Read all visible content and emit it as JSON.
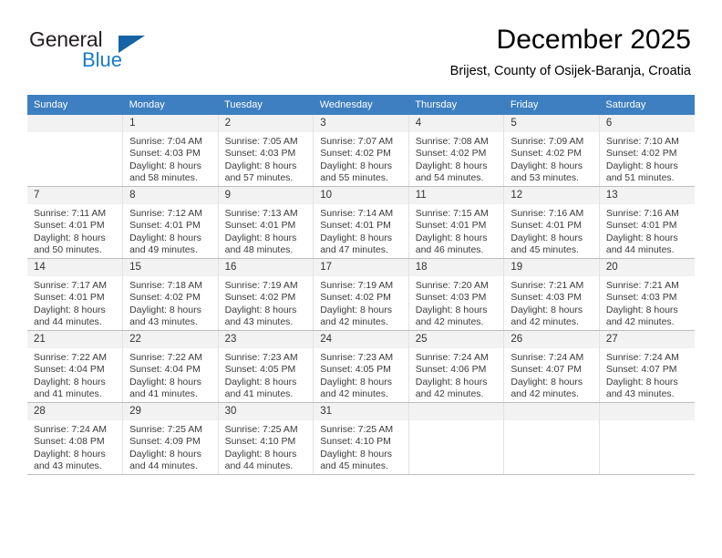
{
  "brand": {
    "name_top": "General",
    "name_bottom": "Blue",
    "triangle_color": "#1464a5",
    "blue_color": "#1a7bc6"
  },
  "header": {
    "title": "December 2025",
    "subtitle": "Brijest, County of Osijek-Baranja, Croatia",
    "header_bg": "#3d7fc1"
  },
  "weekdays": [
    "Sunday",
    "Monday",
    "Tuesday",
    "Wednesday",
    "Thursday",
    "Friday",
    "Saturday"
  ],
  "weeks": [
    [
      {
        "day": "",
        "sunrise": "",
        "sunset": "",
        "daylight1": "",
        "daylight2": ""
      },
      {
        "day": "1",
        "sunrise": "Sunrise: 7:04 AM",
        "sunset": "Sunset: 4:03 PM",
        "daylight1": "Daylight: 8 hours",
        "daylight2": "and 58 minutes."
      },
      {
        "day": "2",
        "sunrise": "Sunrise: 7:05 AM",
        "sunset": "Sunset: 4:03 PM",
        "daylight1": "Daylight: 8 hours",
        "daylight2": "and 57 minutes."
      },
      {
        "day": "3",
        "sunrise": "Sunrise: 7:07 AM",
        "sunset": "Sunset: 4:02 PM",
        "daylight1": "Daylight: 8 hours",
        "daylight2": "and 55 minutes."
      },
      {
        "day": "4",
        "sunrise": "Sunrise: 7:08 AM",
        "sunset": "Sunset: 4:02 PM",
        "daylight1": "Daylight: 8 hours",
        "daylight2": "and 54 minutes."
      },
      {
        "day": "5",
        "sunrise": "Sunrise: 7:09 AM",
        "sunset": "Sunset: 4:02 PM",
        "daylight1": "Daylight: 8 hours",
        "daylight2": "and 53 minutes."
      },
      {
        "day": "6",
        "sunrise": "Sunrise: 7:10 AM",
        "sunset": "Sunset: 4:02 PM",
        "daylight1": "Daylight: 8 hours",
        "daylight2": "and 51 minutes."
      }
    ],
    [
      {
        "day": "7",
        "sunrise": "Sunrise: 7:11 AM",
        "sunset": "Sunset: 4:01 PM",
        "daylight1": "Daylight: 8 hours",
        "daylight2": "and 50 minutes."
      },
      {
        "day": "8",
        "sunrise": "Sunrise: 7:12 AM",
        "sunset": "Sunset: 4:01 PM",
        "daylight1": "Daylight: 8 hours",
        "daylight2": "and 49 minutes."
      },
      {
        "day": "9",
        "sunrise": "Sunrise: 7:13 AM",
        "sunset": "Sunset: 4:01 PM",
        "daylight1": "Daylight: 8 hours",
        "daylight2": "and 48 minutes."
      },
      {
        "day": "10",
        "sunrise": "Sunrise: 7:14 AM",
        "sunset": "Sunset: 4:01 PM",
        "daylight1": "Daylight: 8 hours",
        "daylight2": "and 47 minutes."
      },
      {
        "day": "11",
        "sunrise": "Sunrise: 7:15 AM",
        "sunset": "Sunset: 4:01 PM",
        "daylight1": "Daylight: 8 hours",
        "daylight2": "and 46 minutes."
      },
      {
        "day": "12",
        "sunrise": "Sunrise: 7:16 AM",
        "sunset": "Sunset: 4:01 PM",
        "daylight1": "Daylight: 8 hours",
        "daylight2": "and 45 minutes."
      },
      {
        "day": "13",
        "sunrise": "Sunrise: 7:16 AM",
        "sunset": "Sunset: 4:01 PM",
        "daylight1": "Daylight: 8 hours",
        "daylight2": "and 44 minutes."
      }
    ],
    [
      {
        "day": "14",
        "sunrise": "Sunrise: 7:17 AM",
        "sunset": "Sunset: 4:01 PM",
        "daylight1": "Daylight: 8 hours",
        "daylight2": "and 44 minutes."
      },
      {
        "day": "15",
        "sunrise": "Sunrise: 7:18 AM",
        "sunset": "Sunset: 4:02 PM",
        "daylight1": "Daylight: 8 hours",
        "daylight2": "and 43 minutes."
      },
      {
        "day": "16",
        "sunrise": "Sunrise: 7:19 AM",
        "sunset": "Sunset: 4:02 PM",
        "daylight1": "Daylight: 8 hours",
        "daylight2": "and 43 minutes."
      },
      {
        "day": "17",
        "sunrise": "Sunrise: 7:19 AM",
        "sunset": "Sunset: 4:02 PM",
        "daylight1": "Daylight: 8 hours",
        "daylight2": "and 42 minutes."
      },
      {
        "day": "18",
        "sunrise": "Sunrise: 7:20 AM",
        "sunset": "Sunset: 4:03 PM",
        "daylight1": "Daylight: 8 hours",
        "daylight2": "and 42 minutes."
      },
      {
        "day": "19",
        "sunrise": "Sunrise: 7:21 AM",
        "sunset": "Sunset: 4:03 PM",
        "daylight1": "Daylight: 8 hours",
        "daylight2": "and 42 minutes."
      },
      {
        "day": "20",
        "sunrise": "Sunrise: 7:21 AM",
        "sunset": "Sunset: 4:03 PM",
        "daylight1": "Daylight: 8 hours",
        "daylight2": "and 42 minutes."
      }
    ],
    [
      {
        "day": "21",
        "sunrise": "Sunrise: 7:22 AM",
        "sunset": "Sunset: 4:04 PM",
        "daylight1": "Daylight: 8 hours",
        "daylight2": "and 41 minutes."
      },
      {
        "day": "22",
        "sunrise": "Sunrise: 7:22 AM",
        "sunset": "Sunset: 4:04 PM",
        "daylight1": "Daylight: 8 hours",
        "daylight2": "and 41 minutes."
      },
      {
        "day": "23",
        "sunrise": "Sunrise: 7:23 AM",
        "sunset": "Sunset: 4:05 PM",
        "daylight1": "Daylight: 8 hours",
        "daylight2": "and 41 minutes."
      },
      {
        "day": "24",
        "sunrise": "Sunrise: 7:23 AM",
        "sunset": "Sunset: 4:05 PM",
        "daylight1": "Daylight: 8 hours",
        "daylight2": "and 42 minutes."
      },
      {
        "day": "25",
        "sunrise": "Sunrise: 7:24 AM",
        "sunset": "Sunset: 4:06 PM",
        "daylight1": "Daylight: 8 hours",
        "daylight2": "and 42 minutes."
      },
      {
        "day": "26",
        "sunrise": "Sunrise: 7:24 AM",
        "sunset": "Sunset: 4:07 PM",
        "daylight1": "Daylight: 8 hours",
        "daylight2": "and 42 minutes."
      },
      {
        "day": "27",
        "sunrise": "Sunrise: 7:24 AM",
        "sunset": "Sunset: 4:07 PM",
        "daylight1": "Daylight: 8 hours",
        "daylight2": "and 43 minutes."
      }
    ],
    [
      {
        "day": "28",
        "sunrise": "Sunrise: 7:24 AM",
        "sunset": "Sunset: 4:08 PM",
        "daylight1": "Daylight: 8 hours",
        "daylight2": "and 43 minutes."
      },
      {
        "day": "29",
        "sunrise": "Sunrise: 7:25 AM",
        "sunset": "Sunset: 4:09 PM",
        "daylight1": "Daylight: 8 hours",
        "daylight2": "and 44 minutes."
      },
      {
        "day": "30",
        "sunrise": "Sunrise: 7:25 AM",
        "sunset": "Sunset: 4:10 PM",
        "daylight1": "Daylight: 8 hours",
        "daylight2": "and 44 minutes."
      },
      {
        "day": "31",
        "sunrise": "Sunrise: 7:25 AM",
        "sunset": "Sunset: 4:10 PM",
        "daylight1": "Daylight: 8 hours",
        "daylight2": "and 45 minutes."
      },
      {
        "day": "",
        "sunrise": "",
        "sunset": "",
        "daylight1": "",
        "daylight2": ""
      },
      {
        "day": "",
        "sunrise": "",
        "sunset": "",
        "daylight1": "",
        "daylight2": ""
      },
      {
        "day": "",
        "sunrise": "",
        "sunset": "",
        "daylight1": "",
        "daylight2": ""
      }
    ]
  ]
}
